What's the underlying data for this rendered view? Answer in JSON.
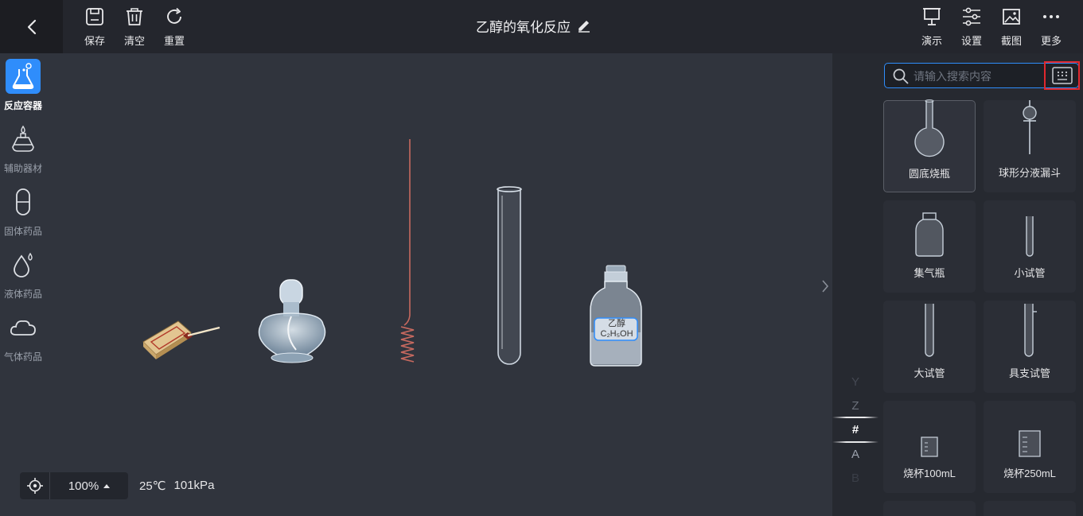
{
  "toolbar": {
    "save": "保存",
    "clear": "清空",
    "reset": "重置",
    "demo": "演示",
    "settings": "设置",
    "screenshot": "截图",
    "more": "更多"
  },
  "title": "乙醇的氧化反应",
  "canvas": {
    "bottle_label_line1": "乙醇",
    "bottle_label_line2": "C₂H₅OH",
    "zoom": "100%",
    "temperature": "25℃",
    "pressure": "101kPa"
  },
  "categories": [
    {
      "label": "反应容器",
      "icon": "flask-icon",
      "active": true
    },
    {
      "label": "辅助器材",
      "icon": "alcohol-lamp-icon",
      "active": false
    },
    {
      "label": "固体药品",
      "icon": "capsule-icon",
      "active": false
    },
    {
      "label": "液体药品",
      "icon": "droplet-icon",
      "active": false
    },
    {
      "label": "气体药品",
      "icon": "cloud-icon",
      "active": false
    }
  ],
  "alpha_index": [
    "Y",
    "Z",
    "#",
    "A",
    "B"
  ],
  "search": {
    "placeholder": "请输入搜索内容",
    "value": ""
  },
  "items": [
    {
      "label": "圆底烧瓶",
      "selected": true
    },
    {
      "label": "球形分液漏斗",
      "selected": false
    },
    {
      "label": "集气瓶",
      "selected": false
    },
    {
      "label": "小试管",
      "selected": false
    },
    {
      "label": "大试管",
      "selected": false
    },
    {
      "label": "具支试管",
      "selected": false
    },
    {
      "label": "烧杯100mL",
      "selected": false
    },
    {
      "label": "烧杯250mL",
      "selected": false
    }
  ],
  "colors": {
    "accent": "#2f8dfb",
    "highlight": "#e0282e"
  }
}
